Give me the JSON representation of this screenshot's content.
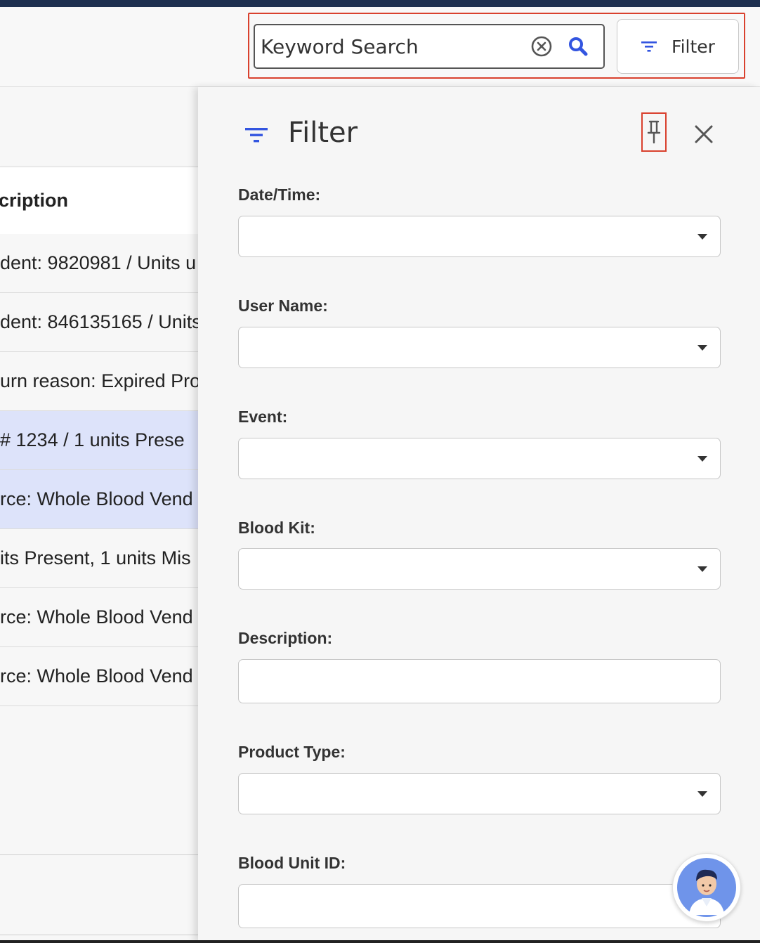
{
  "header": {
    "search": {
      "placeholder": "Keyword Search"
    },
    "filter_button_label": "Filter"
  },
  "table": {
    "header": "cription",
    "rows": [
      {
        "text": "dent: 9820981 / Units u",
        "selected": false
      },
      {
        "text": "dent: 846135165 / Units",
        "selected": false
      },
      {
        "text": "urn reason: Expired Pro",
        "selected": false
      },
      {
        "text": " # 1234 / 1 units Prese",
        "selected": true
      },
      {
        "text": "rce: Whole Blood Vend",
        "selected": true
      },
      {
        "text": "its Present, 1 units Mis",
        "selected": false
      },
      {
        "text": "rce: Whole Blood Vend",
        "selected": false
      },
      {
        "text": "rce: Whole Blood Vend",
        "selected": false
      }
    ]
  },
  "filter_panel": {
    "title": "Filter",
    "fields": {
      "datetime": "Date/Time:",
      "username": "User Name:",
      "event": "Event:",
      "bloodkit": "Blood Kit:",
      "description": "Description:",
      "producttype": "Product Type:",
      "bloodunitid": "Blood Unit ID:"
    }
  },
  "colors": {
    "accent": "#3355e0",
    "highlight_border": "#d9412e",
    "selected_row": "#dde3fa"
  },
  "icons": [
    "clear-icon",
    "search-icon",
    "filter-icon",
    "pin-icon",
    "close-icon",
    "assistant-avatar-icon"
  ]
}
